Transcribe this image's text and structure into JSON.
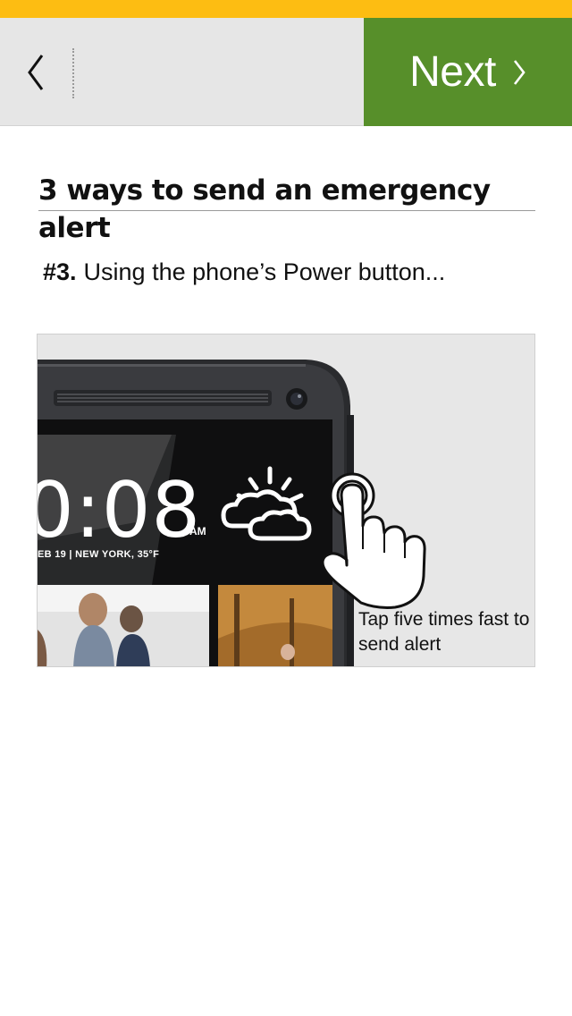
{
  "header": {
    "back_icon": "chevron-left-icon",
    "next_label": "Next",
    "next_icon": "chevron-right-icon"
  },
  "colors": {
    "status_strip": "#fdbd12",
    "header_bg": "#e6e6e6",
    "next_bg": "#578f2a"
  },
  "content": {
    "title": "3 ways to send an emergency alert",
    "step_number": "#3.",
    "step_text": "Using the phone’s Power button..."
  },
  "illustration": {
    "clock_time": "0:08",
    "clock_am": "AM",
    "clock_date": "EB 19 | NEW YORK, 35°F",
    "caption": "Tap five times fast to send alert",
    "icons": [
      "phone-image",
      "weather-sun-cloud-icon",
      "tap-hand-icon"
    ]
  }
}
